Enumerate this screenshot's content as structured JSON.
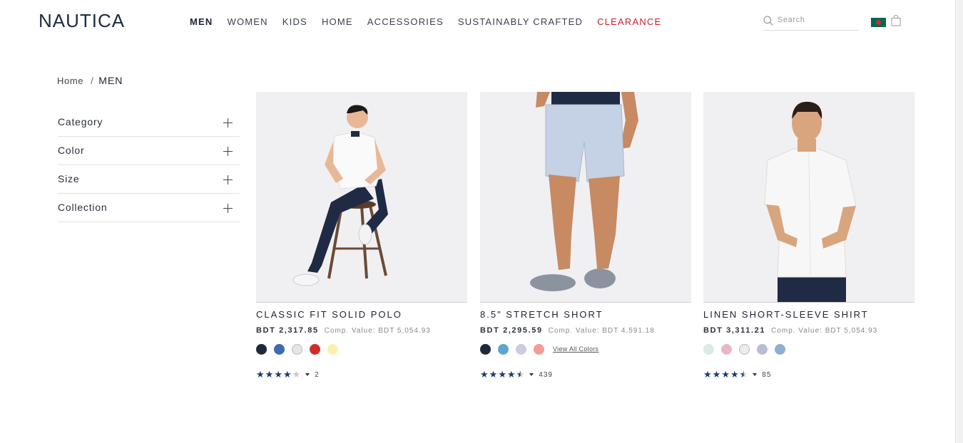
{
  "brand": {
    "logo": "NAUTICA"
  },
  "nav": [
    {
      "label": "MEN",
      "active": true
    },
    {
      "label": "WOMEN"
    },
    {
      "label": "KIDS"
    },
    {
      "label": "HOME"
    },
    {
      "label": "ACCESSORIES"
    },
    {
      "label": "SUSTAINABLY CRAFTED"
    },
    {
      "label": "CLEARANCE",
      "highlight": "#c8202f"
    }
  ],
  "search": {
    "placeholder": "Search"
  },
  "icons": {
    "search": "search-icon",
    "bag": "shopping-bag-icon",
    "flag": "bangladesh-flag-icon",
    "expand": "plus-icon",
    "caret": "caret-down-icon"
  },
  "breadcrumb": {
    "home": "Home",
    "separator": "/",
    "current": "MEN"
  },
  "filters": [
    {
      "label": "Category"
    },
    {
      "label": "Color"
    },
    {
      "label": "Size"
    },
    {
      "label": "Collection"
    }
  ],
  "products": [
    {
      "name": "CLASSIC FIT SOLID POLO",
      "price": "BDT 2,317.85",
      "comp_value": "Comp. Value: BDT 5,054.93",
      "swatches": [
        "#1e2a3c",
        "#3b6bb0",
        "#e6e6e8",
        "#d12d2d",
        "#fbf0b0"
      ],
      "view_all": "",
      "rating": 4,
      "review_count": "2"
    },
    {
      "name": "8.5\" STRETCH SHORT",
      "price": "BDT 2,295.59",
      "comp_value": "Comp. Value: BDT 4,591.18",
      "swatches": [
        "#1e2a3c",
        "#5aa6d0",
        "#c9cde0",
        "#f59a9a"
      ],
      "view_all": "View All Colors",
      "rating": 4.5,
      "review_count": "439"
    },
    {
      "name": "LINEN SHORT-SLEEVE SHIRT",
      "price": "BDT 3,311.21",
      "comp_value": "Comp. Value: BDT 5,054.93",
      "swatches": [
        "#d8ebe6",
        "#e8b7c6",
        "#ececef",
        "#b8bdd4",
        "#8eafd4"
      ],
      "view_all": "",
      "rating": 4.5,
      "review_count": "85"
    }
  ]
}
